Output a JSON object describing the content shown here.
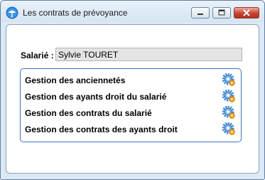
{
  "window": {
    "title": "Les contrats de prévoyance"
  },
  "salarie": {
    "label": "Salarié :",
    "value": "Sylvie TOURET"
  },
  "menu": {
    "items": [
      {
        "label": "Gestion des anciennetés",
        "icon": "gear-icon"
      },
      {
        "label": "Gestion des ayants droit du salarié",
        "icon": "gear-icon"
      },
      {
        "label": "Gestion des contrats du salarié",
        "icon": "gear-icon"
      },
      {
        "label": "Gestion des contrats des ayants droit",
        "icon": "gear-icon"
      }
    ]
  },
  "colors": {
    "gear_blue": "#3a86d8",
    "gear_orange": "#f0a020",
    "group_border": "#3b76bb",
    "close_red": "#c8432f"
  }
}
